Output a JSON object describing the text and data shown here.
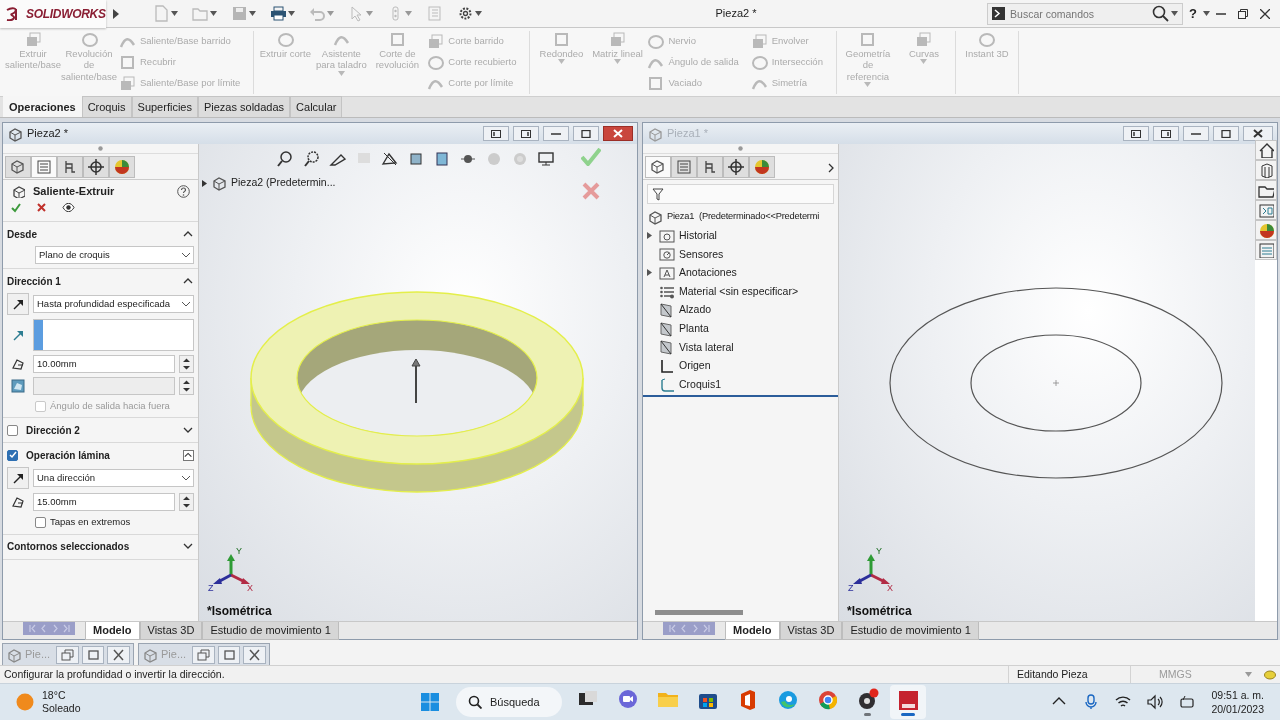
{
  "app": {
    "logo": "SOLIDWORKS",
    "title": "Pieza2 *",
    "search": {
      "placeholder": "Buscar comandos"
    },
    "help": "?"
  },
  "ribbon": {
    "groups": [
      {
        "items": [
          {
            "kind": "large",
            "label": "Extruir saliente/base",
            "disabled": true,
            "dropdown": false
          },
          {
            "kind": "large",
            "label": "Revolución de saliente/base",
            "disabled": true,
            "dropdown": false
          },
          {
            "kind": "stack",
            "items": [
              {
                "label": "Saliente/Base barrido",
                "disabled": true
              },
              {
                "label": "Recubrir",
                "disabled": true
              },
              {
                "label": "Saliente/Base por límite",
                "disabled": true
              }
            ]
          }
        ]
      },
      {
        "items": [
          {
            "kind": "large",
            "label": "Extruir corte",
            "disabled": true,
            "dropdown": false
          },
          {
            "kind": "large",
            "label": "Asistente para taladro",
            "disabled": true,
            "dropdown": true
          },
          {
            "kind": "large",
            "label": "Corte de revolución",
            "disabled": true,
            "dropdown": false
          },
          {
            "kind": "stack",
            "items": [
              {
                "label": "Corte barrido",
                "disabled": true
              },
              {
                "label": "Corte recubierto",
                "disabled": true
              },
              {
                "label": "Corte por límite",
                "disabled": true
              }
            ]
          }
        ]
      },
      {
        "items": [
          {
            "kind": "large",
            "label": "Redondeo",
            "disabled": true,
            "dropdown": true
          },
          {
            "kind": "large",
            "label": "Matriz lineal",
            "disabled": true,
            "dropdown": true
          },
          {
            "kind": "stack",
            "items": [
              {
                "label": "Nervio",
                "disabled": true
              },
              {
                "label": "Ángulo de salida",
                "disabled": true
              },
              {
                "label": "Vaciado",
                "disabled": true
              }
            ]
          },
          {
            "kind": "stack",
            "items": [
              {
                "label": "Envolver",
                "disabled": true
              },
              {
                "label": "Intersección",
                "disabled": true
              },
              {
                "label": "Simetría",
                "disabled": true
              }
            ]
          }
        ]
      },
      {
        "items": [
          {
            "kind": "large",
            "label": "Geometría de referencia",
            "disabled": true,
            "dropdown": true
          },
          {
            "kind": "large",
            "label": "Curvas",
            "disabled": true,
            "dropdown": true
          }
        ]
      },
      {
        "items": [
          {
            "kind": "large",
            "label": "Instant 3D",
            "disabled": true,
            "dropdown": false
          }
        ]
      }
    ]
  },
  "command_tabs": [
    {
      "label": "Operaciones",
      "selected": true
    },
    {
      "label": "Croquis",
      "selected": false
    },
    {
      "label": "Superficies",
      "selected": false
    },
    {
      "label": "Piezas soldadas",
      "selected": false
    },
    {
      "label": "Calcular",
      "selected": false
    }
  ],
  "windows": [
    {
      "title": "Pieza2 *",
      "active": true,
      "panel": {
        "kind": "property_manager",
        "tabs": [
          {
            "kind": "feature_tree",
            "selected": false
          },
          {
            "kind": "property",
            "selected": true
          },
          {
            "kind": "configuration",
            "selected": false
          },
          {
            "kind": "dimxpert",
            "selected": false
          },
          {
            "kind": "display",
            "selected": false
          }
        ],
        "title": "Saliente-Extruir",
        "sections": [
          {
            "kind": "plain",
            "title": "Desde",
            "expanded": true,
            "rows": [
              {
                "kind": "select",
                "value": "Plano de croquis"
              }
            ]
          },
          {
            "kind": "plain",
            "title": "Dirección 1",
            "expanded": true,
            "rows": [
              {
                "kind": "direction_select",
                "value": "Hasta profundidad especificada"
              },
              {
                "kind": "listbox"
              },
              {
                "kind": "number",
                "value": "10.00mm",
                "disabled": false
              },
              {
                "kind": "number",
                "disabled": true
              },
              {
                "kind": "checkbox",
                "label": "Ángulo de salida hacia fuera",
                "checked": false,
                "disabled": true
              }
            ]
          },
          {
            "kind": "checkable",
            "title": "Dirección 2",
            "checked": false,
            "expanded": false
          },
          {
            "kind": "checkable",
            "title": "Operación lámina",
            "checked": true,
            "expanded": true,
            "rows": [
              {
                "kind": "direction_select",
                "value": "Una dirección"
              },
              {
                "kind": "number",
                "value": "15.00mm",
                "disabled": false
              },
              {
                "kind": "checkbox",
                "label": "Tapas en extremos",
                "checked": false,
                "disabled": false
              }
            ]
          },
          {
            "kind": "plain",
            "title": "Contornos seleccionados",
            "expanded": false
          }
        ]
      },
      "viewport": {
        "kind": "extrusion",
        "tree_label": "Pieza2 (Predetermin...",
        "view_label": "*Isométrica",
        "triad": [
          "X",
          "Y",
          "Z"
        ]
      },
      "bottom_tabs": [
        {
          "label": "Modelo",
          "selected": true
        },
        {
          "label": "Vistas 3D",
          "selected": false
        },
        {
          "label": "Estudio de movimiento 1",
          "selected": false
        }
      ]
    },
    {
      "title": "Pieza1 *",
      "active": false,
      "panel": {
        "kind": "feature_tree",
        "tabs": [
          {
            "kind": "feature_tree",
            "selected": true
          },
          {
            "kind": "property",
            "selected": false
          },
          {
            "kind": "configuration",
            "selected": false
          },
          {
            "kind": "dimxpert",
            "selected": false
          },
          {
            "kind": "display",
            "selected": false
          }
        ],
        "root": "Pieza1  (Predeterminado<<Predetermi",
        "items": [
          {
            "kind": "history",
            "label": "Historial",
            "expandable": true
          },
          {
            "kind": "sensors",
            "label": "Sensores",
            "expandable": false
          },
          {
            "kind": "annotations",
            "label": "Anotaciones",
            "expandable": true
          },
          {
            "kind": "material",
            "label": "Material <sin especificar>",
            "expandable": false
          },
          {
            "kind": "plane",
            "label": "Alzado",
            "expandable": false
          },
          {
            "kind": "plane",
            "label": "Planta",
            "expandable": false
          },
          {
            "kind": "plane",
            "label": "Vista lateral",
            "expandable": false
          },
          {
            "kind": "origin",
            "label": "Origen",
            "expandable": false
          },
          {
            "kind": "sketch",
            "label": "Croquis1",
            "expandable": false
          }
        ]
      },
      "viewport": {
        "kind": "sketch",
        "view_label": "*Isométrica",
        "triad": [
          "X",
          "Y",
          "Z"
        ]
      },
      "bottom_tabs": [
        {
          "label": "Modelo",
          "selected": true
        },
        {
          "label": "Vistas 3D",
          "selected": false
        },
        {
          "label": "Estudio de movimiento 1",
          "selected": false
        }
      ]
    }
  ],
  "minimized_windows": [
    {
      "title": "Pie..."
    },
    {
      "title": "Pie..."
    }
  ],
  "status_bar": {
    "message": "Configurar la profundidad o invertir la dirección.",
    "mode": "Editando Pieza",
    "units": "MMGS"
  },
  "taskbar": {
    "weather": {
      "temperature": "18°C",
      "condition": "Soleado"
    },
    "search": "Búsqueda",
    "apps": [
      {
        "kind": "taskview",
        "running": false,
        "active": false
      },
      {
        "kind": "chat",
        "running": false,
        "active": false
      },
      {
        "kind": "files",
        "running": false,
        "active": false
      },
      {
        "kind": "store",
        "running": false,
        "active": false
      },
      {
        "kind": "office",
        "running": false,
        "active": false
      },
      {
        "kind": "edge",
        "running": false,
        "active": false
      },
      {
        "kind": "chrome",
        "running": false,
        "active": false
      },
      {
        "kind": "recorder",
        "running": true,
        "active": false
      },
      {
        "kind": "cad",
        "running": true,
        "active": true
      }
    ],
    "time": "09:51 a. m.",
    "date": "20/01/2023"
  }
}
